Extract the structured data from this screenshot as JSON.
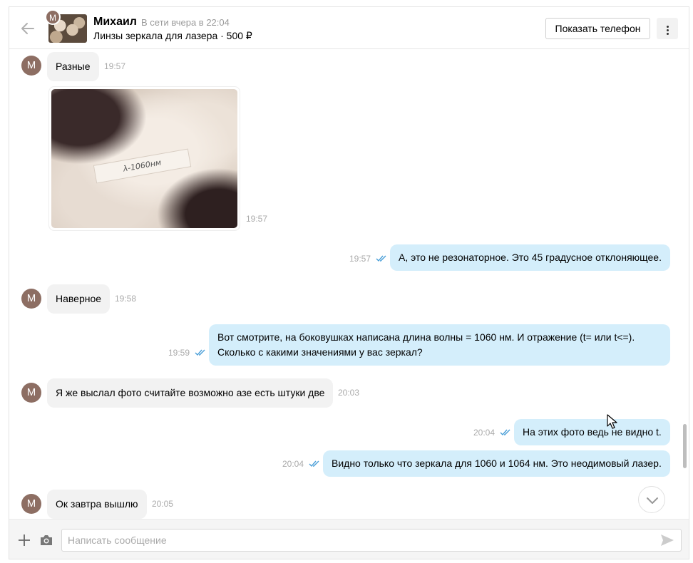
{
  "header": {
    "avatar_letter": "М",
    "contact_name": "Михаил",
    "status": "В сети вчера в 22:04",
    "ad_title": "Линзы зеркала для лазера · 500 ₽",
    "show_phone_label": "Показать телефон"
  },
  "messages": [
    {
      "id": "m1",
      "direction": "in",
      "avatar": "М",
      "text": "Разные",
      "time": "19:57"
    },
    {
      "id": "m2",
      "direction": "in",
      "type": "photo",
      "time": "19:57",
      "photo_caption": "λ-1060нм"
    },
    {
      "id": "m3",
      "direction": "out",
      "text": "А, это не резонаторное. Это 45 градусное отклоняющее.",
      "time": "19:57",
      "read": true
    },
    {
      "id": "m4",
      "direction": "in",
      "avatar": "М",
      "text": "Наверное",
      "time": "19:58"
    },
    {
      "id": "m5",
      "direction": "out",
      "text_line1": "Вот смотрите, на боковушках написана длина волны = 1060 нм. И отражение (t= или t<=).",
      "text_line2": "Сколько с какими значениями у вас зеркал?",
      "time": "19:59",
      "read": true
    },
    {
      "id": "m6",
      "direction": "in",
      "avatar": "М",
      "text": "Я же выслал фото считайте возможно азе есть штуки две",
      "time": "20:03"
    },
    {
      "id": "m7",
      "direction": "out",
      "text": "На этих фото ведь не видно t.",
      "time": "20:04",
      "read": true
    },
    {
      "id": "m8",
      "direction": "out",
      "text": "Видно только что зеркала для 1060 и 1064 нм. Это неодимовый лазер.",
      "time": "20:04",
      "read": true
    },
    {
      "id": "m9",
      "direction": "in",
      "avatar": "М",
      "text": "Ок завтра вышлю",
      "time": "20:05"
    }
  ],
  "composer": {
    "placeholder": "Написать сообщение"
  },
  "colors": {
    "incoming_bubble": "#f2f2f2",
    "outgoing_bubble": "#d4eefb",
    "avatar": "#8d6e63",
    "read_ticks": "#4a9fd8"
  },
  "icons": [
    "back-arrow-icon",
    "more-vertical-icon",
    "read-ticks-icon",
    "chevron-down-icon",
    "plus-icon",
    "camera-icon",
    "send-icon"
  ]
}
